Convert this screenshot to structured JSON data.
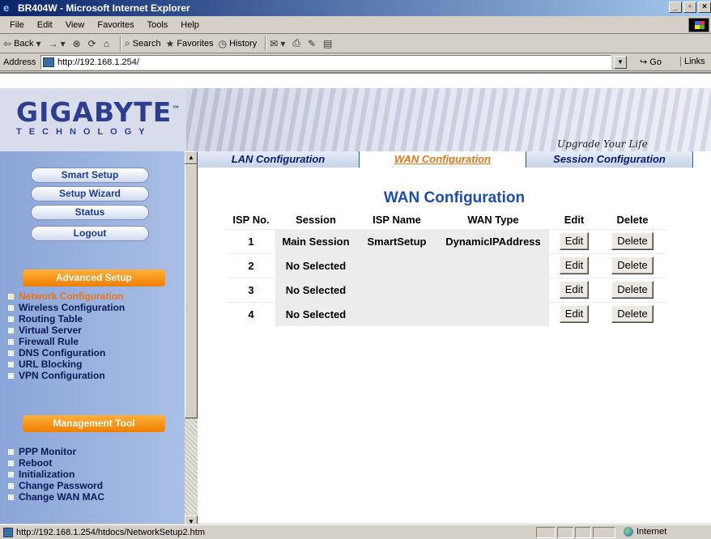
{
  "window": {
    "title": "BR404W - Microsoft Internet Explorer",
    "buttons": [
      "_",
      "▫",
      "×"
    ]
  },
  "menu": [
    "File",
    "Edit",
    "View",
    "Favorites",
    "Tools",
    "Help"
  ],
  "toolbar": {
    "back": "Back",
    "forward_icon": "→",
    "stop_icon": "⊗",
    "refresh_icon": "⟳",
    "home_icon": "⌂",
    "search": "Search",
    "favorites": "Favorites",
    "history": "History"
  },
  "address": {
    "label": "Address",
    "url": "http://192.168.1.254/",
    "go": "Go",
    "links": "Links"
  },
  "banner": {
    "logo": "GIGABYTE",
    "logo_tm": "™",
    "logo_sub": "TECHNOLOGY",
    "slogan": "Upgrade Your Life"
  },
  "nav": {
    "buttons": [
      "Smart Setup",
      "Setup Wizard",
      "Status",
      "Logout"
    ],
    "advanced_header": "Advanced Setup",
    "advanced_items": [
      "Network Configuration",
      "Wireless Configuration",
      "Routing Table",
      "Virtual Server",
      "Firewall Rule",
      "DNS Configuration",
      "URL Blocking",
      "VPN Configuration"
    ],
    "management_header": "Management Tool",
    "management_items": [
      "PPP Monitor",
      "Reboot",
      "Initialization",
      "Change Password",
      "Change WAN MAC"
    ]
  },
  "tabs": [
    "LAN Configuration",
    "WAN Configuration",
    "Session Configuration"
  ],
  "main": {
    "title": "WAN Configuration",
    "columns": [
      "ISP No.",
      "Session",
      "ISP Name",
      "WAN Type",
      "Edit",
      "Delete"
    ],
    "rows": [
      {
        "no": "1",
        "session": "Main Session",
        "isp": "SmartSetup",
        "type": "DynamicIPAddress",
        "edit": "Edit",
        "delete": "Delete"
      },
      {
        "no": "2",
        "session": "No Selected",
        "isp": "",
        "type": "",
        "edit": "Edit",
        "delete": "Delete"
      },
      {
        "no": "3",
        "session": "No Selected",
        "isp": "",
        "type": "",
        "edit": "Edit",
        "delete": "Delete"
      },
      {
        "no": "4",
        "session": "No Selected",
        "isp": "",
        "type": "",
        "edit": "Edit",
        "delete": "Delete"
      }
    ]
  },
  "status": {
    "url": "http://192.168.1.254/htdocs/NetworkSetup2.htm",
    "zone": "Internet"
  }
}
